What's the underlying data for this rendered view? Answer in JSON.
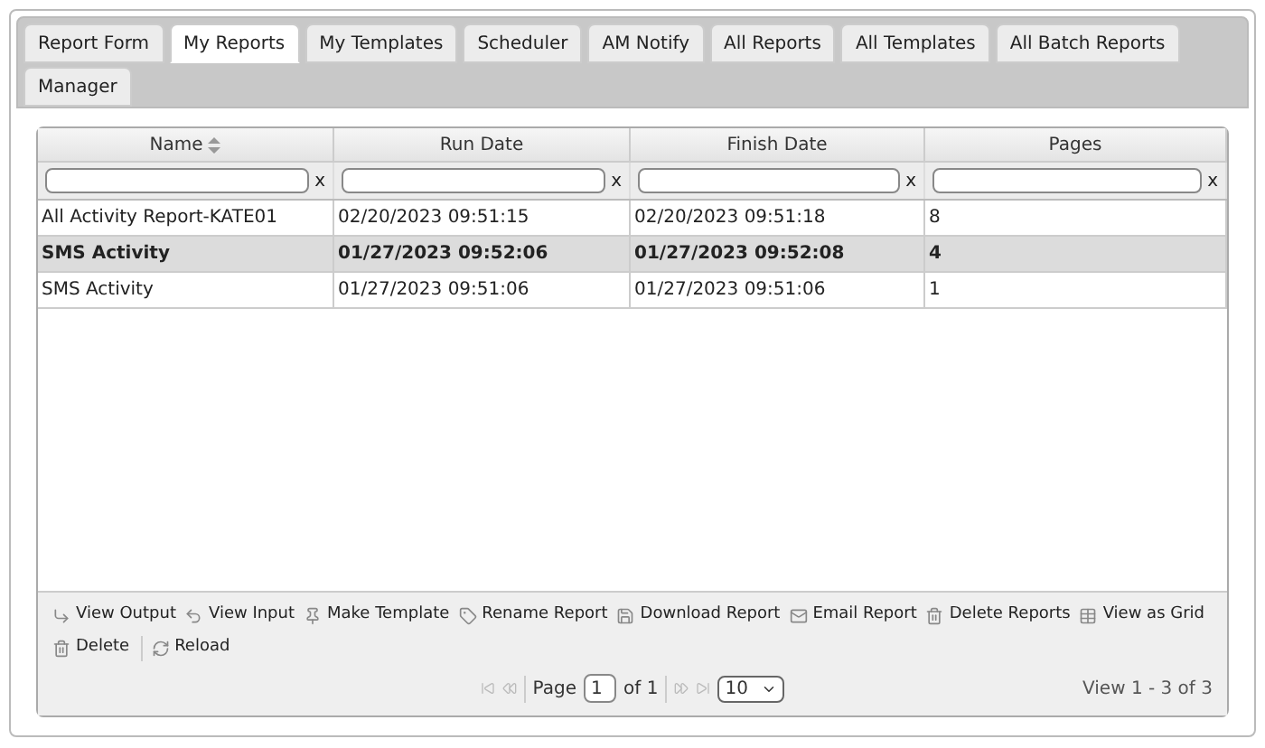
{
  "tabs": [
    {
      "label": "Report Form",
      "selected": false
    },
    {
      "label": "My Reports",
      "selected": true
    },
    {
      "label": "My Templates",
      "selected": false
    },
    {
      "label": "Scheduler",
      "selected": false
    },
    {
      "label": "AM Notify",
      "selected": false
    },
    {
      "label": "All Reports",
      "selected": false
    },
    {
      "label": "All Templates",
      "selected": false
    },
    {
      "label": "All Batch Reports",
      "selected": false
    },
    {
      "label": "Manager",
      "selected": false
    }
  ],
  "grid": {
    "columns": [
      {
        "label": "Name",
        "sorted": true,
        "filter_clear": "x"
      },
      {
        "label": "Run Date",
        "sorted": false,
        "filter_clear": "x"
      },
      {
        "label": "Finish Date",
        "sorted": false,
        "filter_clear": "x"
      },
      {
        "label": "Pages",
        "sorted": false,
        "filter_clear": "x"
      }
    ],
    "rows": [
      {
        "cells": [
          "All Activity Report-KATE01",
          "02/20/2023 09:51:15",
          "02/20/2023 09:51:18",
          "8"
        ],
        "selected": false
      },
      {
        "cells": [
          "SMS Activity",
          "01/27/2023 09:52:06",
          "01/27/2023 09:52:08",
          "4"
        ],
        "selected": true
      },
      {
        "cells": [
          "SMS Activity",
          "01/27/2023 09:51:06",
          "01/27/2023 09:51:06",
          "1"
        ],
        "selected": false
      }
    ],
    "actions": [
      "View Output",
      "View Input",
      "Make Template",
      "Rename Report",
      "Download Report",
      "Email Report",
      "Delete Reports",
      "View as Grid",
      "Delete",
      "Reload"
    ],
    "pager": {
      "page_label": "Page",
      "page": "1",
      "of": "of 1",
      "page_size": "10",
      "summary": "View 1 - 3 of 3"
    }
  }
}
